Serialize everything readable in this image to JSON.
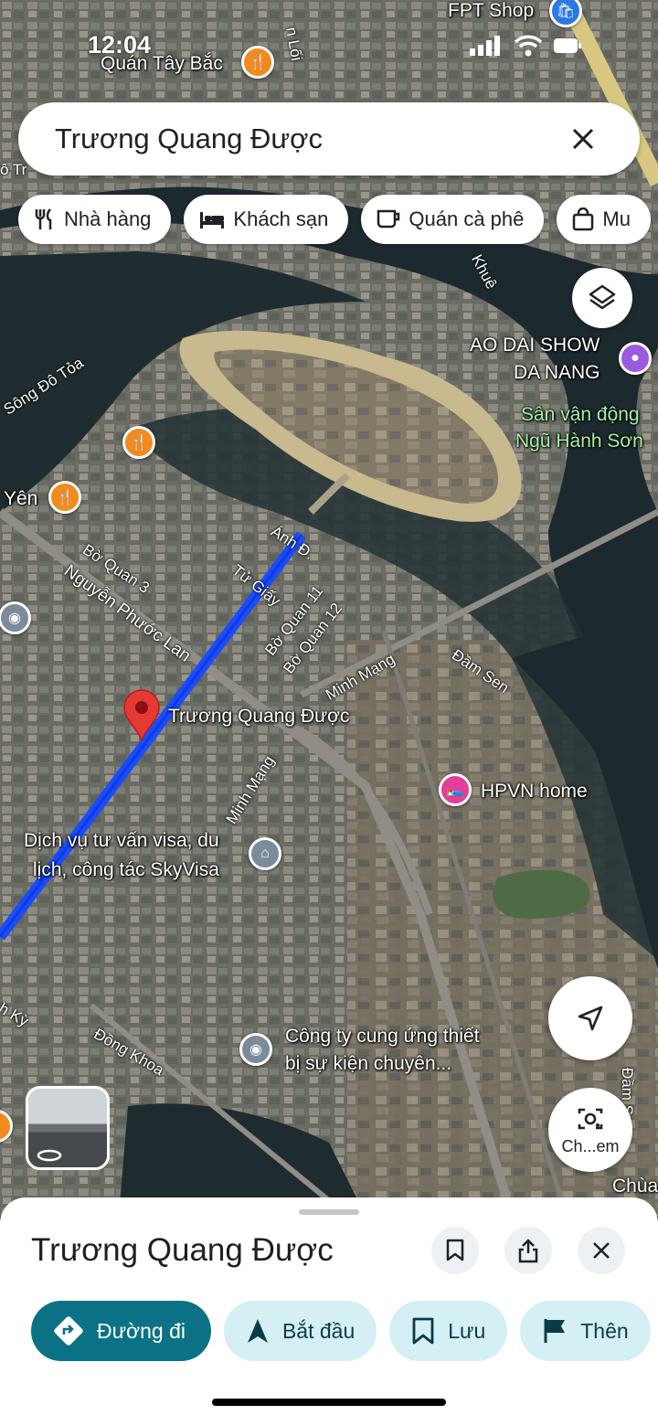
{
  "status_bar": {
    "time": "12:04"
  },
  "search": {
    "query": "Trương Quang Được"
  },
  "chips": [
    {
      "label": "Nhà hàng",
      "icon": "fork-knife-icon"
    },
    {
      "label": "Khách sạn",
      "icon": "bed-icon"
    },
    {
      "label": "Quán cà phê",
      "icon": "coffee-icon"
    },
    {
      "label": "Mu",
      "icon": "shopping-bag-icon"
    }
  ],
  "map": {
    "places": {
      "fpt_shop": "FPT Shop",
      "quan_tay_bac": "Quán Tây Bắc",
      "ao_dai_line1": "AO DAI SHOW",
      "ao_dai_line2": "DA NANG",
      "stadium_line1": "Sân vận động",
      "stadium_line2": "Ngũ Hành Sơn",
      "yen": "Yên",
      "hpvn": "HPVN home",
      "visa_line1": "Dịch vụ tư vấn visa, du",
      "visa_line2": "lịch, công tác SkyVisa",
      "event_line1": "Công ty cung ứng thiết",
      "event_line2": "bị sự kiện chuyên...",
      "selected": "Trương Quang Được",
      "chua": "Chùa"
    },
    "streets": {
      "song_do_toa": "Sông Đô Tỏa",
      "bo_quan_3": "Bờ Quan 3",
      "nguyen_phuoc_lan": "Nguyễn Phước Lan",
      "tu_giay": "Tử Giấy",
      "anh_d": "Ánh Đ.",
      "bo_quan_11": "Bờ Quan 11",
      "bo_quan_12": "Bờ Quan 12",
      "minh_mang_1": "Minh Mạng",
      "minh_mang_2": "Minh Mạng",
      "dam_sen_1": "Đầm Sen",
      "dam_sen_2": "Đầm Sen",
      "dong_khoa": "Đồng Khoa",
      "khue": "Khuê",
      "h_ky": "h Kỳ",
      "lo_i": "n Lối",
      "bo_t": "ô Tr"
    }
  },
  "lens_button": {
    "label": "Ch...em"
  },
  "sheet": {
    "title": "Trương Quang Được",
    "actions": [
      {
        "label": "Đường đi",
        "icon": "directions-icon"
      },
      {
        "label": "Bắt đầu",
        "icon": "navigation-arrow-icon"
      },
      {
        "label": "Lưu",
        "icon": "bookmark-icon"
      },
      {
        "label": "Thên",
        "icon": "flag-icon"
      }
    ]
  },
  "colors": {
    "route": "#1a4cff",
    "primary": "#0b7285",
    "pin_red": "#e53935"
  }
}
